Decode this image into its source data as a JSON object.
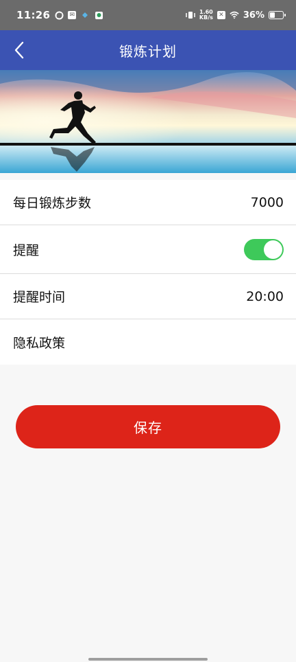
{
  "status_bar": {
    "time": "11:26",
    "net_speed_top": "1.60",
    "net_speed_bottom": "KB/s",
    "battery_percent": "36%",
    "battery_level": 0.36
  },
  "app_bar": {
    "title": "锻炼计划",
    "back_icon": "chevron-left-icon"
  },
  "settings": {
    "daily_steps": {
      "label": "每日锻炼步数",
      "value": "7000"
    },
    "reminder": {
      "label": "提醒",
      "enabled": true
    },
    "reminder_time": {
      "label": "提醒时间",
      "value": "20:00"
    },
    "privacy": {
      "label": "隐私政策"
    }
  },
  "save_button": {
    "label": "保存"
  },
  "colors": {
    "app_bar": "#3b53b3",
    "toggle_on": "#3ec95a",
    "save_button": "#dd2419"
  }
}
